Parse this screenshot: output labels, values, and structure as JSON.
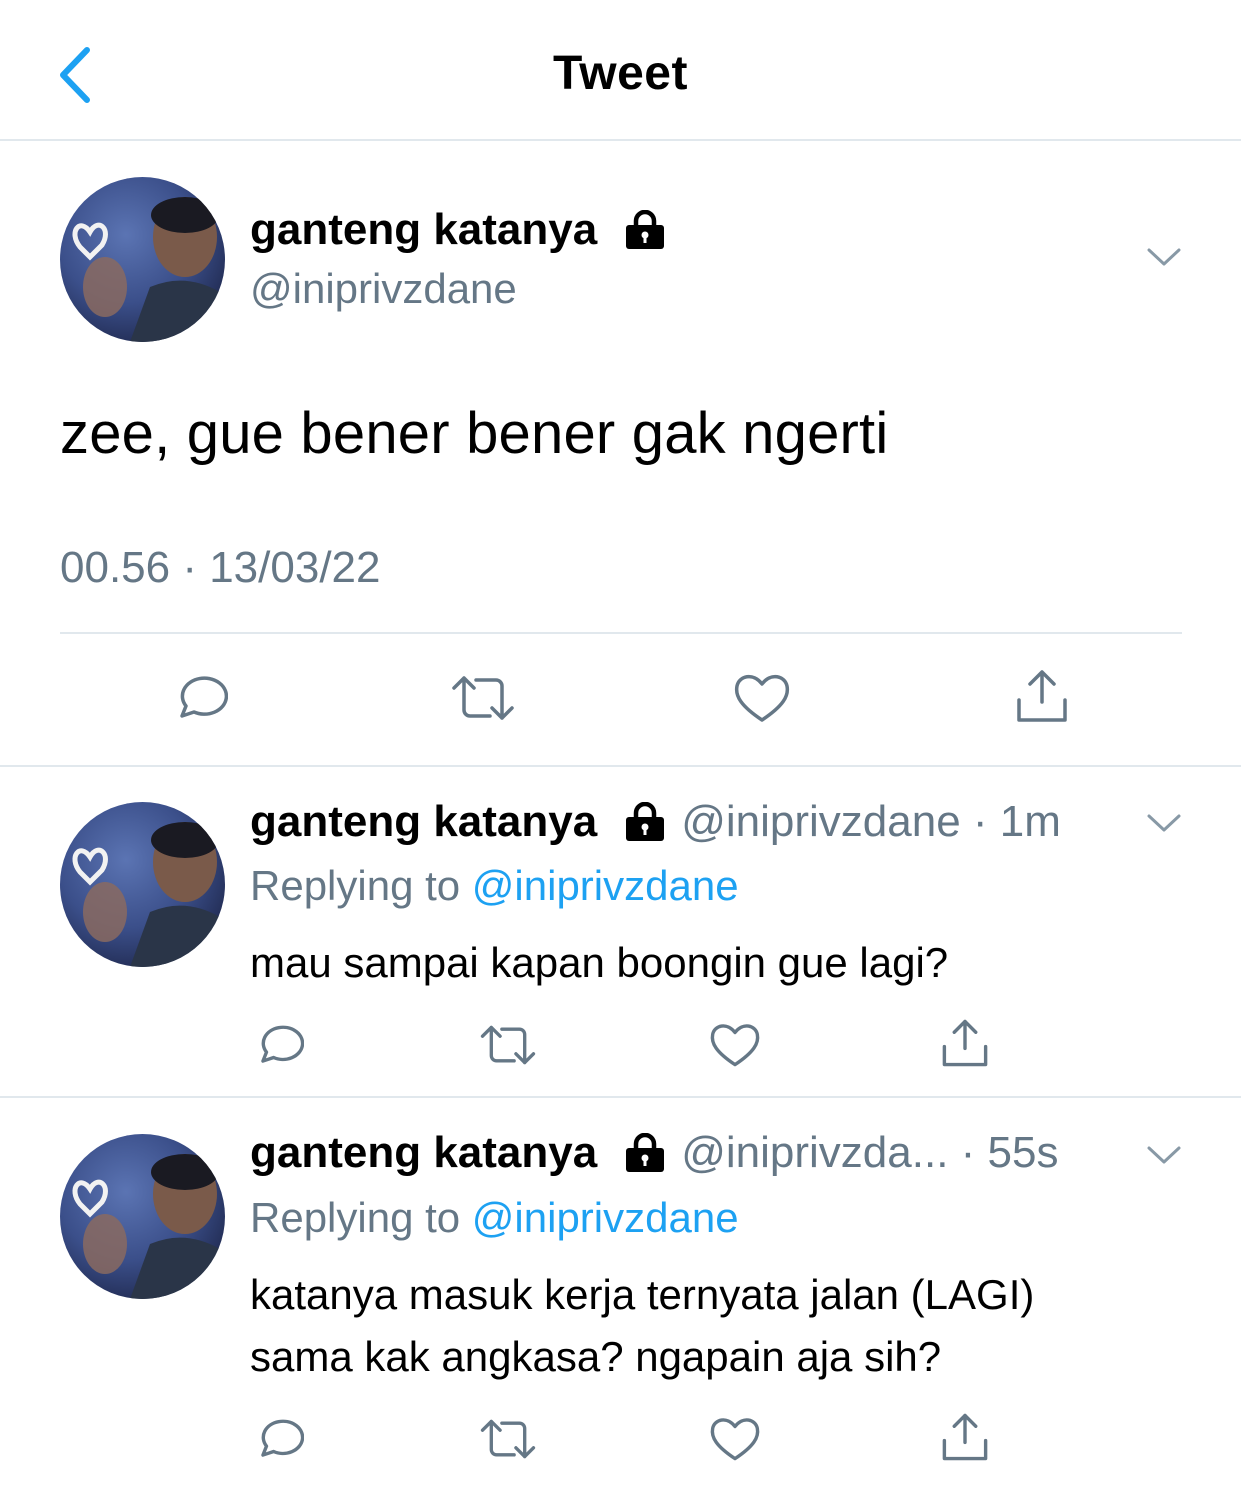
{
  "header": {
    "title": "Tweet"
  },
  "main_tweet": {
    "name": "ganteng katanya",
    "handle": "@iniprivzdane",
    "text": "zee, gue bener bener gak ngerti",
    "timestamp": "00.56 · 13/03/22"
  },
  "replies": [
    {
      "name": "ganteng katanya",
      "handle": "@iniprivzdane",
      "separator": " · ",
      "time": "1m",
      "replying_prefix": "Replying to ",
      "replying_to": "@iniprivzdane",
      "text_lines": [
        "mau sampai kapan boongin gue lagi?"
      ]
    },
    {
      "name": "ganteng katanya",
      "handle": "@iniprivzda...",
      "separator": " · ",
      "time": "55s",
      "replying_prefix": "Replying to ",
      "replying_to": "@iniprivzdane",
      "text_lines": [
        "katanya masuk kerja ternyata jalan (LAGI)",
        "sama kak angkasa? ngapain aja sih?"
      ]
    }
  ],
  "colors": {
    "accent": "#1da1f2",
    "secondary_text": "#657786",
    "icon": "#657786",
    "divider": "#e1e8ed"
  },
  "icons": [
    "chevron-left-icon",
    "lock-icon",
    "chevron-down-icon",
    "reply-icon",
    "retweet-icon",
    "like-icon",
    "share-icon"
  ]
}
